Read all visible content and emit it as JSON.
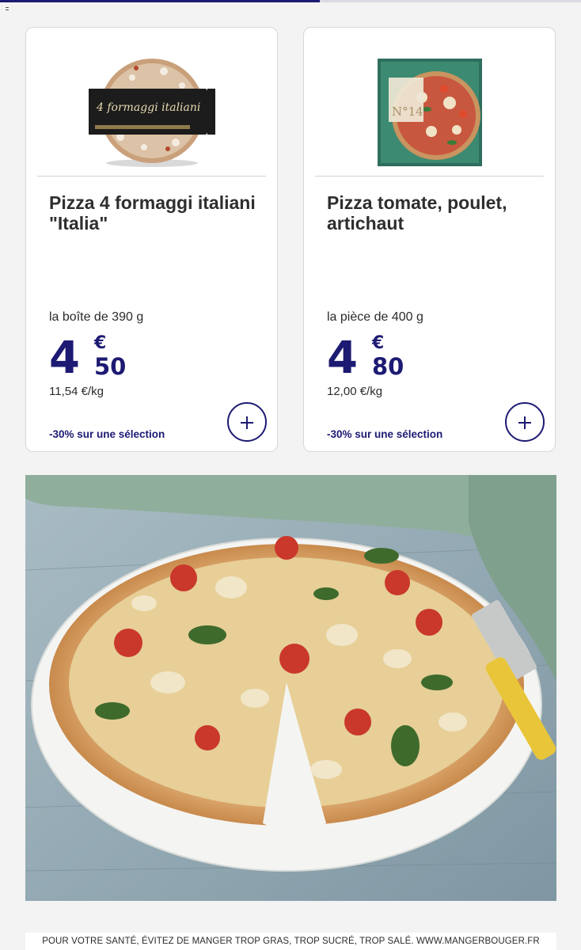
{
  "progress": {
    "value_percent": 55,
    "color": "#1d1a73"
  },
  "products": [
    {
      "image": {
        "label": "4 formaggi italiani",
        "icon": "pizza-4-formaggi-box-image"
      },
      "name": "Pizza 4 formaggi italiani \"Italia\"",
      "unit": "la boîte de 390 g",
      "price_int": "4",
      "price_currency": "€",
      "price_dec": "50",
      "price_per_kg": "11,54 €/kg",
      "promo": "-30% sur une sélection"
    },
    {
      "image": {
        "label": "N°14",
        "icon": "pizza-tomate-poulet-box-image"
      },
      "name": "Pizza tomate, poulet, artichaut",
      "unit": "la pièce de 400 g",
      "price_int": "4",
      "price_currency": "€",
      "price_dec": "80",
      "price_per_kg": "12,00 €/kg",
      "promo": "-30% sur une sélection"
    }
  ],
  "footer": {
    "text": "POUR VOTRE SANTÉ, ÉVITEZ DE MANGER TROP GRAS, TROP SUCRÉ, TROP SALÉ. WWW.MANGERBOUGER.FR"
  },
  "colors": {
    "brand": "#1d1a73",
    "card_border": "#d7d7d7",
    "background": "#f3f3f3"
  }
}
